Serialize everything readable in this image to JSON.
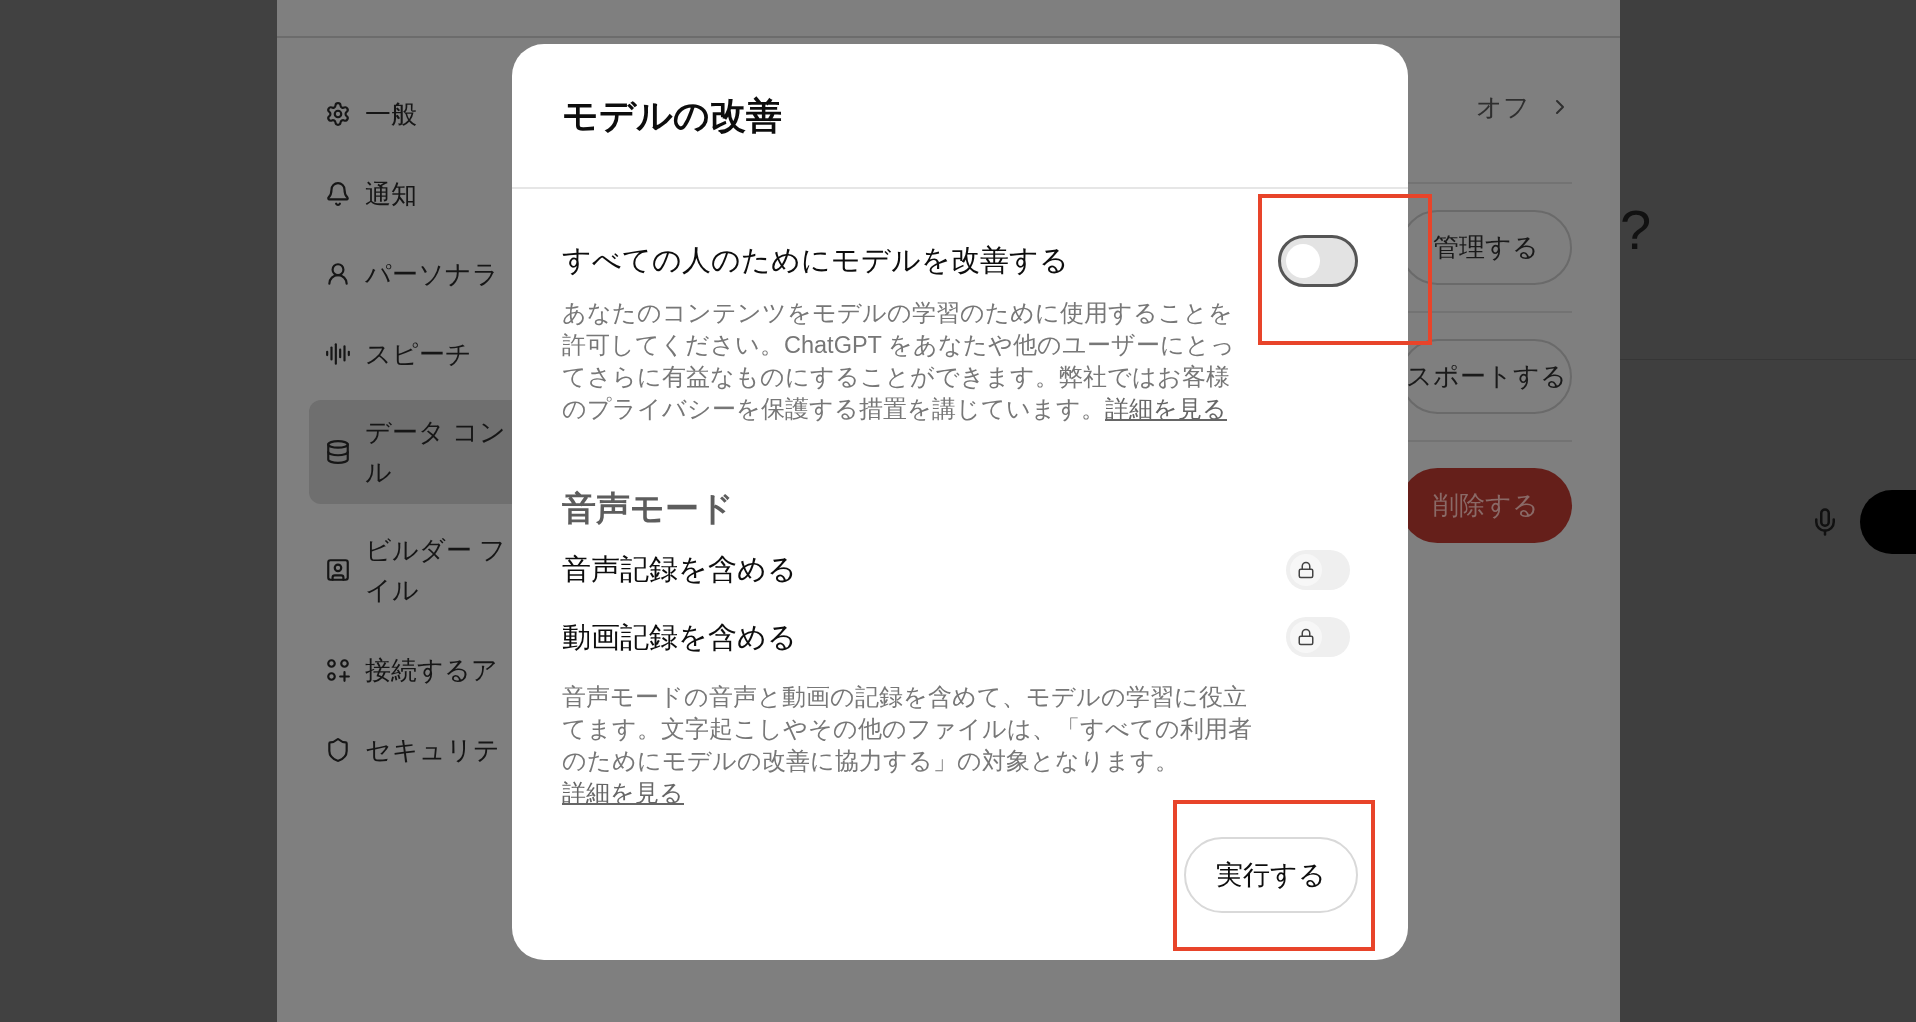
{
  "sidebar": {
    "items": [
      {
        "label_lines": [
          "一般"
        ],
        "selected": false
      },
      {
        "label_lines": [
          "通知"
        ],
        "selected": false
      },
      {
        "label_lines": [
          "パーソナラ"
        ],
        "selected": false
      },
      {
        "label_lines": [
          "スピーチ"
        ],
        "selected": false
      },
      {
        "label_lines": [
          "データ コン",
          "ル"
        ],
        "selected": true
      },
      {
        "label_lines": [
          "ビルダー フ",
          "イル"
        ],
        "selected": false
      },
      {
        "label_lines": [
          "接続するア"
        ],
        "selected": false
      },
      {
        "label_lines": [
          "セキュリテ"
        ],
        "selected": false
      }
    ]
  },
  "settings_rows": [
    {
      "kind": "value",
      "value": "オフ"
    },
    {
      "kind": "button",
      "label": "管理する"
    },
    {
      "kind": "button",
      "label": "スポートする"
    },
    {
      "kind": "danger_button",
      "label": "削除する"
    }
  ],
  "background_heading": "?",
  "dialog": {
    "title": "モデルの改善",
    "main_toggle": {
      "label": "すべての人のためにモデルを改善する",
      "on": false,
      "description": "あなたのコンテンツをモデルの学習のために使用することを許可してください。ChatGPT をあなたや他のユーザーにとってさらに有益なものにすることができます。弊社ではお客様のプライバシーを保護する措置を講じています。",
      "link": "詳細を見る"
    },
    "voice_section": {
      "heading": "音声モード",
      "toggles": [
        {
          "label": "音声記録を含める",
          "on": false,
          "locked": true
        },
        {
          "label": "動画記録を含める",
          "on": false,
          "locked": true
        }
      ],
      "description": "音声モードの音声と動画の記録を含めて、モデルの学習に役立てます。文字起こしやその他のファイルは、「すべての利用者のためにモデルの改善に協力する」の対象となります。",
      "link": "詳細を見る"
    },
    "action_button": "実行する"
  }
}
